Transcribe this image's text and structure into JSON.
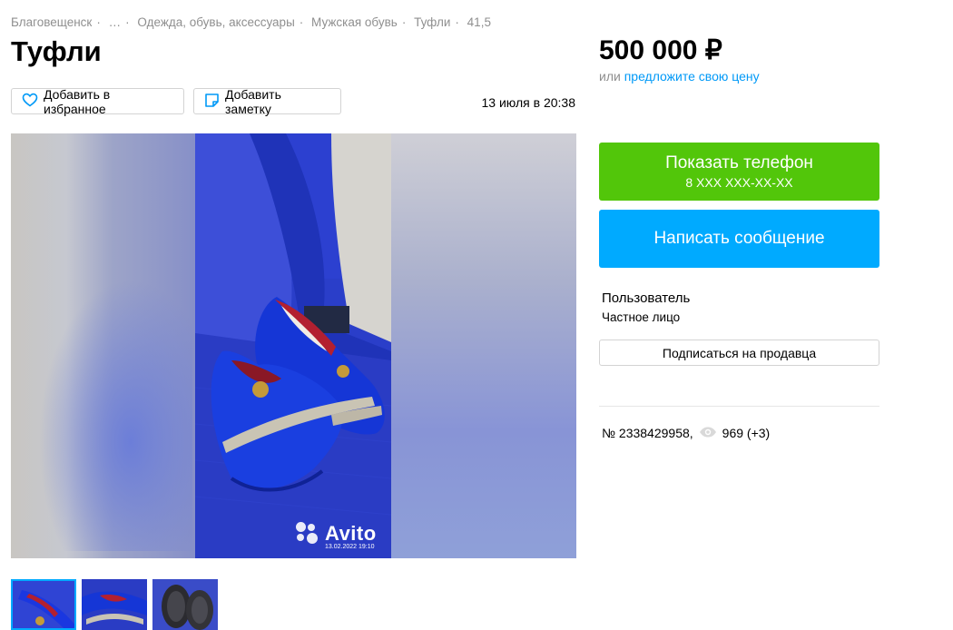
{
  "breadcrumbs": [
    "Благовещенск",
    "…",
    "Одежда, обувь, аксессуары",
    "Мужская обувь",
    "Туфли",
    "41,5"
  ],
  "title": "Туфли",
  "actions": {
    "favorite_label": "Добавить в избранное",
    "note_label": "Добавить заметку"
  },
  "posted_date": "13 июля в 20:38",
  "gallery": {
    "watermark_brand": "Avito",
    "watermark_date": "13.02.2022 19:10",
    "thumbnails": 3,
    "active_index": 0
  },
  "price": {
    "value": "500 000 ₽",
    "offer_prefix": "или",
    "offer_link": "предложите свою цену"
  },
  "contact": {
    "phone_label": "Показать телефон",
    "phone_masked": "8 XXX XXX-XX-XX",
    "message_label": "Написать сообщение"
  },
  "seller": {
    "name": "Пользователь",
    "type": "Частное лицо",
    "subscribe_label": "Подписаться на продавца"
  },
  "stats": {
    "listing_number": "№ 2338429958,",
    "views": "969 (+3)"
  },
  "colors": {
    "green": "#52c60a",
    "blue": "#00aaff",
    "link": "#0099f7",
    "muted": "#8f8f8f"
  }
}
